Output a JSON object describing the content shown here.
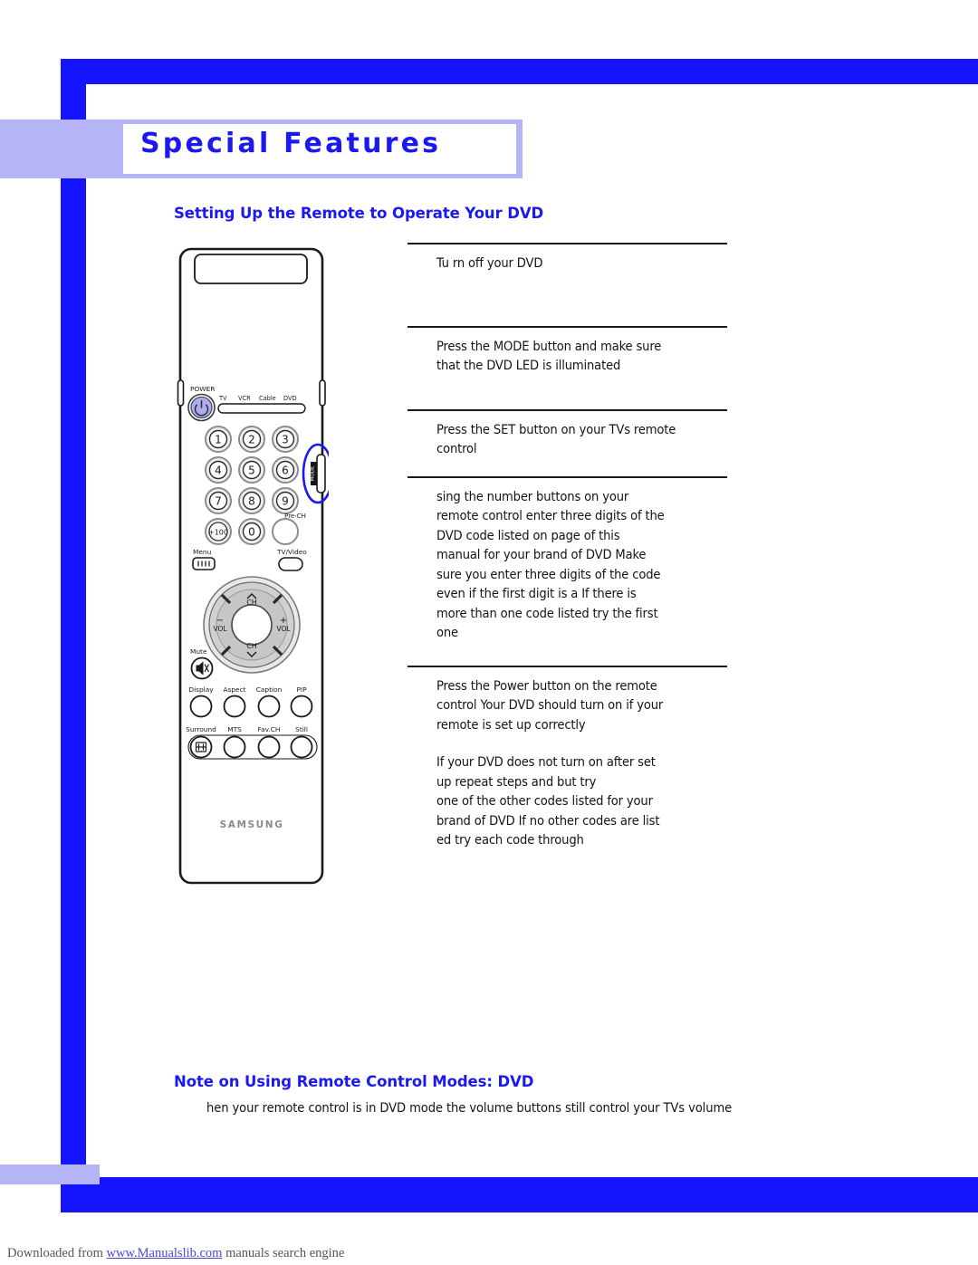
{
  "page": {
    "header_title": "Special Features",
    "accent_blue": "#1a1aee",
    "frame_blue": "#1414ff",
    "band_lavender": "#b4b4f7"
  },
  "sections": {
    "dvd_setup_heading": "Setting Up the Remote to Operate Your DVD",
    "note_heading": "Note on Using Remote Control Modes: DVD",
    "note_text": "hen your remote control is in DVD mode  the volume buttons still control your TVs volume"
  },
  "steps": [
    {
      "id": "step-turn-off-dvd",
      "lines": [
        "Tu rn  off your DVD"
      ]
    },
    {
      "id": "step-press-mode",
      "lines": [
        "Press the MODE button and make sure",
        "that the DVD LED is illuminated"
      ]
    },
    {
      "id": "step-press-set",
      "lines": [
        "Press the SET button on your TVs remote",
        "control"
      ]
    },
    {
      "id": "step-enter-code",
      "lines": [
        " sing the number buttons on your",
        "remote control  enter three digits of the",
        "DVD code listed on page      of this",
        "manual for your brand of DVD  Make",
        "sure you enter three digits of the code",
        "even if the first digit is a    If there is",
        "more than one code listed  try the first",
        "one"
      ]
    },
    {
      "id": "step-press-power",
      "paragraphs": [
        [
          "Press the Power button on the remote",
          "control  Your DVD should turn on if your",
          "remote is set up correctly"
        ],
        [
          "If your DVD does not turn on after set",
          "up  repeat steps        and    but try",
          "one of the other codes listed for your",
          "brand of DVD  If no other codes are list",
          "ed  try each code        through"
        ]
      ]
    }
  ],
  "remote": {
    "brand": "SAMSUNG",
    "power_label": "POWER",
    "power_button_color": "#b0aee6",
    "mode_button_label": "MODE",
    "callout_color": "#1a1aee",
    "device_labels": [
      "TV",
      "VCR",
      "Cable",
      "DVD"
    ],
    "numbers": [
      "1",
      "2",
      "3",
      "4",
      "5",
      "6",
      "7",
      "8",
      "9"
    ],
    "plus100_label": "+100",
    "zero_label": "0",
    "prech_label": "Pre-CH",
    "menu_label": "Menu",
    "tvvideo_label": "TV/Video",
    "mute_label": "Mute",
    "ch_up_label": "CH",
    "ch_down_label": "CH",
    "vol_down_label": "VOL",
    "vol_up_label": "VOL",
    "vol_minus": "−",
    "vol_plus": "+",
    "row1_labels": [
      "Display",
      "Aspect",
      "Caption",
      "PIP"
    ],
    "row2_labels": [
      "Surround",
      "MTS",
      "Fav.CH",
      "Still"
    ]
  },
  "footer": {
    "prefix": "Downloaded from ",
    "link": "www.Manualslib.com",
    "suffix": " manuals search engine"
  }
}
